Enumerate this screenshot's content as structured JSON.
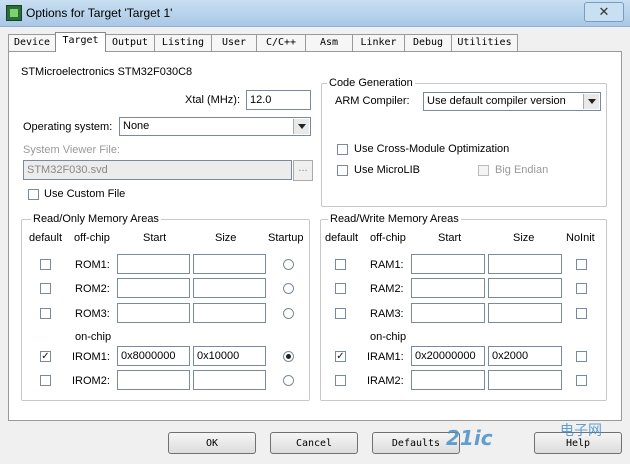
{
  "window": {
    "title": "Options for Target 'Target 1'",
    "close_glyph": "✕",
    "icon": "keil-window-icon"
  },
  "tabs": [
    {
      "label": "Device",
      "active": false
    },
    {
      "label": "Target",
      "active": true
    },
    {
      "label": "Output",
      "active": false
    },
    {
      "label": "Listing",
      "active": false
    },
    {
      "label": "User",
      "active": false
    },
    {
      "label": "C/C++",
      "active": false
    },
    {
      "label": "Asm",
      "active": false
    },
    {
      "label": "Linker",
      "active": false
    },
    {
      "label": "Debug",
      "active": false
    },
    {
      "label": "Utilities",
      "active": false
    }
  ],
  "device_name": "STMicroelectronics STM32F030C8",
  "xtal": {
    "label": "Xtal (MHz):",
    "value": "12.0"
  },
  "os": {
    "label": "Operating system:",
    "value": "None"
  },
  "svd": {
    "label": "System Viewer File:",
    "value": "STM32F030.svd",
    "browse": "..."
  },
  "custom_file": {
    "label": "Use Custom File",
    "checked": false
  },
  "codegen": {
    "title": "Code Generation",
    "compiler_label": "ARM Compiler:",
    "compiler_value": "Use default compiler version",
    "cross_module": "Use Cross-Module Optimization",
    "microlib": "Use MicroLIB",
    "big_endian": "Big Endian"
  },
  "ro_memory": {
    "title": "Read/Only Memory Areas",
    "headers": {
      "default": "default",
      "offchip": "off-chip",
      "start": "Start",
      "size": "Size",
      "startup": "Startup"
    },
    "onchip_label": "on-chip",
    "rows": [
      {
        "name": "ROM1:",
        "start": "",
        "size": "",
        "default": false,
        "startup": false
      },
      {
        "name": "ROM2:",
        "start": "",
        "size": "",
        "default": false,
        "startup": false
      },
      {
        "name": "ROM3:",
        "start": "",
        "size": "",
        "default": false,
        "startup": false
      },
      {
        "name": "IROM1:",
        "start": "0x8000000",
        "size": "0x10000",
        "default": true,
        "startup": true
      },
      {
        "name": "IROM2:",
        "start": "",
        "size": "",
        "default": false,
        "startup": false
      }
    ]
  },
  "rw_memory": {
    "title": "Read/Write Memory Areas",
    "headers": {
      "default": "default",
      "offchip": "off-chip",
      "start": "Start",
      "size": "Size",
      "noinit": "NoInit"
    },
    "onchip_label": "on-chip",
    "rows": [
      {
        "name": "RAM1:",
        "start": "",
        "size": "",
        "default": false,
        "noinit": false
      },
      {
        "name": "RAM2:",
        "start": "",
        "size": "",
        "default": false,
        "noinit": false
      },
      {
        "name": "RAM3:",
        "start": "",
        "size": "",
        "default": false,
        "noinit": false
      },
      {
        "name": "IRAM1:",
        "start": "0x20000000",
        "size": "0x2000",
        "default": true,
        "noinit": false
      },
      {
        "name": "IRAM2:",
        "start": "",
        "size": "",
        "default": false,
        "noinit": false
      }
    ]
  },
  "buttons": {
    "ok": "OK",
    "cancel": "Cancel",
    "defaults": "Defaults",
    "help": "Help"
  },
  "watermark": {
    "text": "21ic",
    "sub": "电子网"
  }
}
